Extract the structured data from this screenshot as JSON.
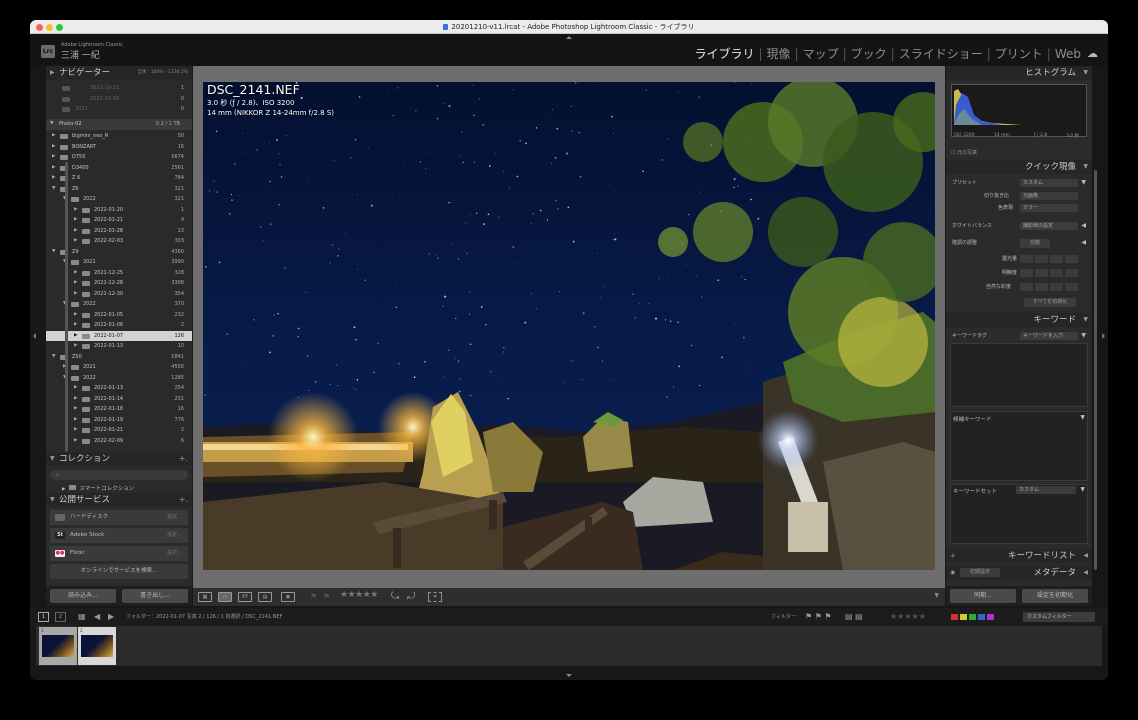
{
  "window": {
    "title": "20201210-v11.lrcat - Adobe Photoshop Lightroom Classic - ライブラリ"
  },
  "identity": {
    "logo": "Lrc",
    "app_name": "Adobe Lightroom Classic",
    "user": "三浦 一紀"
  },
  "modules": [
    "ライブラリ",
    "現像",
    "マップ",
    "ブック",
    "スライドショー",
    "プリント",
    "Web"
  ],
  "left": {
    "navigator": {
      "title": "ナビゲーター",
      "zoom_fit": "全体",
      "zoom_100": "100%",
      "zoom_ratio": "1134.2%"
    },
    "volume": {
      "name": "Photo-02",
      "space": "0.2 / 1 TB"
    },
    "folders_top": [
      {
        "name": "2021-10-21",
        "count": "1"
      },
      {
        "name": "2021-10-28",
        "count": "0"
      },
      {
        "name": "2022",
        "count": "0"
      }
    ],
    "folders": [
      {
        "name": "bigmini_neo_R",
        "count": "50"
      },
      {
        "name": "BONZART",
        "count": "16"
      },
      {
        "name": "D750",
        "count": "5674"
      },
      {
        "name": "D3400",
        "count": "2561"
      },
      {
        "name": "Z 6",
        "count": "784"
      },
      {
        "name": "Z6",
        "count": "321"
      },
      {
        "name": "2022",
        "count": "321"
      },
      {
        "name": "2022-01-20",
        "count": "1"
      },
      {
        "name": "2022-01-21",
        "count": "4"
      },
      {
        "name": "2022-01-28",
        "count": "13"
      },
      {
        "name": "2022-02-03",
        "count": "303"
      },
      {
        "name": "Z9",
        "count": "4360"
      },
      {
        "name": "2021",
        "count": "3990"
      },
      {
        "name": "2021-12-25",
        "count": "328"
      },
      {
        "name": "2021-12-28",
        "count": "3308"
      },
      {
        "name": "2021-12-30",
        "count": "354"
      },
      {
        "name": "2022",
        "count": "370"
      },
      {
        "name": "2022-01-05",
        "count": "232"
      },
      {
        "name": "2022-01-06",
        "count": "2"
      },
      {
        "name": "2022-01-07",
        "count": "126"
      },
      {
        "name": "2022-01-13",
        "count": "10"
      },
      {
        "name": "Z50",
        "count": "5841"
      },
      {
        "name": "2021",
        "count": "4556"
      },
      {
        "name": "2022",
        "count": "1285"
      },
      {
        "name": "2022-01-13",
        "count": "254"
      },
      {
        "name": "2022-01-14",
        "count": "231"
      },
      {
        "name": "2022-01-18",
        "count": "16"
      },
      {
        "name": "2022-01-19",
        "count": "776"
      },
      {
        "name": "2022-01-21",
        "count": "2"
      },
      {
        "name": "2022-02-09",
        "count": "6"
      }
    ],
    "collections": {
      "title": "コレクション",
      "search": "",
      "smart": "スマートコレクション"
    },
    "services": {
      "title": "公開サービス",
      "items": [
        {
          "label": "ハードディスク",
          "setting": "設定..."
        },
        {
          "label": "Adobe Stock",
          "setting": "設定..."
        },
        {
          "label": "Flickr",
          "setting": "設定..."
        }
      ],
      "find_more": "オンラインでサービスを検索..."
    },
    "import_btn": "読み込み...",
    "export_btn": "書き出し..."
  },
  "photo": {
    "filename": "DSC_2141.NEF",
    "exposure": "3.0 秒 (ƒ / 2.8)、ISO 3200",
    "lens": "14 mm (NIKKOR Z 14-24mm f/2.8 S)"
  },
  "right": {
    "histogram": {
      "title": "ヒストグラム",
      "iso": "ISO 3200",
      "focal": "14 mm",
      "aperture": "ƒ / 2.8",
      "shutter": "3.0 秒",
      "original": "元の写真"
    },
    "quick": {
      "title": "クイック現像",
      "preset_label": "プリセット",
      "preset_value": "カスタム",
      "crop_label": "切り抜き比",
      "crop_value": "元画像",
      "treat_label": "色表現",
      "treat_value": "カラー",
      "wb_label": "ホワイトバランス",
      "wb_value": "撮影時の設定",
      "tone_label": "階調の調整",
      "auto": "自動",
      "exposure": "露光量",
      "clarity": "明瞭度",
      "vibrance": "自然な彩度",
      "reset": "すべてを初期化"
    },
    "keywords": {
      "title": "キーワード",
      "tag_label": "キーワードタグ",
      "tag_value": "キーワードを入力",
      "suggest": "候補キーワード",
      "set_label": "キーワードセット",
      "set_value": "カスタム"
    },
    "keyword_list": "キーワードリスト",
    "metadata": {
      "title": "メタデータ",
      "preset": "初期設定"
    },
    "sync_btn": "同期...",
    "reset_btn": "設定を初期化"
  },
  "filmbar": {
    "pages": [
      "1",
      "2"
    ],
    "path": "フォルダー：2022-01-07  写真 2 / 126 / 1 枚選択 / DSC_2141.NEF",
    "filter_label": "フィルター：",
    "filter_value": "カスタムフィルター"
  },
  "colors": {
    "accent": "#d8d8d8",
    "swatches": [
      "#c33",
      "#cc3",
      "#3a3",
      "#36c",
      "#a3c"
    ]
  }
}
